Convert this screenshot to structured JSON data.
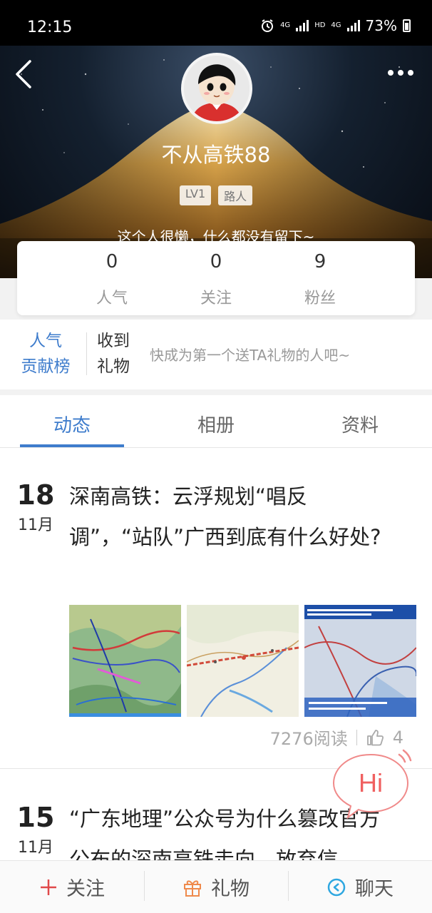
{
  "status_bar": {
    "time": "12:15",
    "network_1": "4G",
    "network_hd": "HD",
    "network_2": "4G",
    "battery": "73%"
  },
  "profile": {
    "username": "不从高铁88",
    "level": "LV1",
    "rank_tag": "路人",
    "bio": "这个人很懒，什么都没有留下~",
    "stats": [
      {
        "value": "0",
        "label": "人气"
      },
      {
        "value": "0",
        "label": "关注"
      },
      {
        "value": "9",
        "label": "粉丝"
      }
    ]
  },
  "gifts": {
    "rank_line1": "人气",
    "rank_line2": "贡献榜",
    "received_line1": "收到",
    "received_line2": "礼物",
    "hint": "快成为第一个送TA礼物的人吧~"
  },
  "tabs": [
    "动态",
    "相册",
    "资料"
  ],
  "posts": [
    {
      "day": "18",
      "month": "11月",
      "title": "深南高铁：云浮规划“唱反调”，“站队”广西到底有什么好处?",
      "reads": "7276阅读",
      "likes": "4"
    },
    {
      "day": "15",
      "month": "11月",
      "title": "“广东地理”公众号为什么篡改官方公布的深南高铁走向，放弃信"
    }
  ],
  "bubble": {
    "text": "Hi"
  },
  "bottom_bar": {
    "follow": "关注",
    "gift": "礼物",
    "chat": "聊天"
  },
  "colors": {
    "accent": "#3e7ccc",
    "follow_icon": "#e0494a",
    "gift_icon": "#ef8a4c",
    "chat_icon": "#2ea7e0",
    "bubble": "#f06060"
  }
}
